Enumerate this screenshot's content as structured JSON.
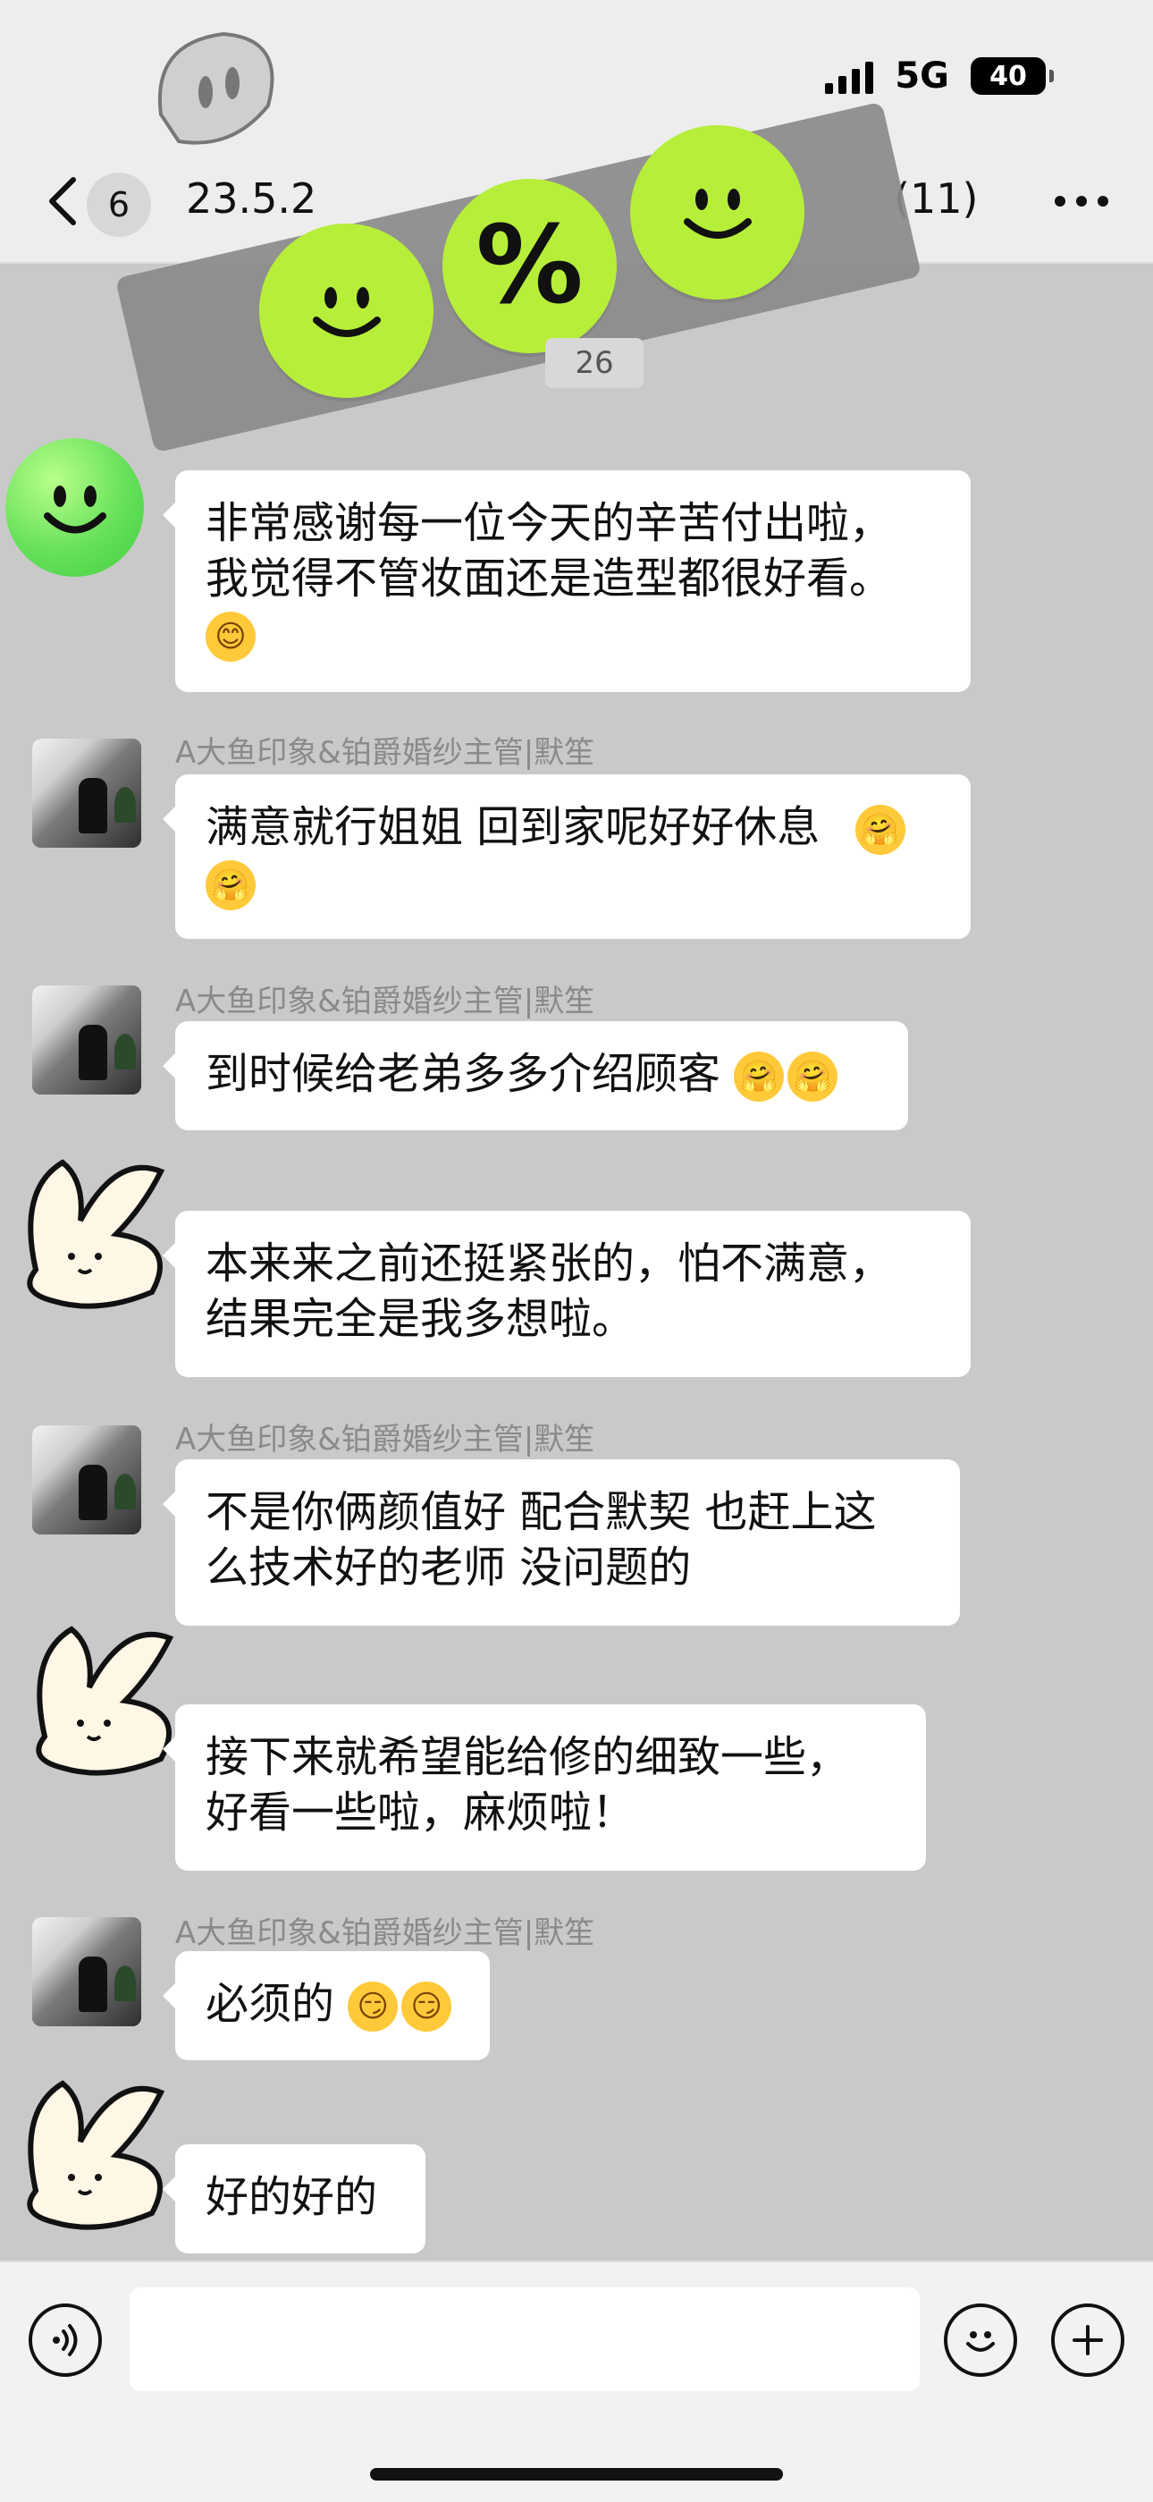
{
  "status_bar": {
    "network": "5G",
    "battery": "40"
  },
  "nav": {
    "back_count": "6",
    "title": "23.5.2",
    "member_count": "(11)"
  },
  "chat": {
    "time_chip": "26",
    "messages": [
      {
        "sender": "",
        "text_lines": [
          "非常感谢每一位今天的辛苦付出啦，",
          "我觉得不管妆面还是造型都很好看。"
        ],
        "emoji_line": "😊"
      },
      {
        "sender": "A大鱼印象&铂爵婚纱主管|默笙",
        "text_lines": [
          "满意就行姐姐 回到家呢好好休息"
        ],
        "emoji_line": "🤗🤗"
      },
      {
        "sender": "A大鱼印象&铂爵婚纱主管|默笙",
        "text_lines": [
          "到时候给老弟多多介绍顾客"
        ],
        "emoji_line": "🤗🤗"
      },
      {
        "sender": "",
        "text_lines": [
          "本来来之前还挺紧张的，怕不满意，",
          "结果完全是我多想啦。"
        ]
      },
      {
        "sender": "A大鱼印象&铂爵婚纱主管|默笙",
        "text_lines": [
          "不是你俩颜值好 配合默契 也赶上这",
          "么技术好的老师 没问题的"
        ]
      },
      {
        "sender": "",
        "text_lines": [
          "接下来就希望能给修的细致一些，",
          "好看一些啦，麻烦啦！"
        ]
      },
      {
        "sender": "A大鱼印象&铂爵婚纱主管|默笙",
        "text_lines": [
          "必须的"
        ],
        "emoji_line": "😏😏"
      },
      {
        "sender": "",
        "text_lines": [
          "好的好的"
        ]
      }
    ]
  },
  "input": {
    "placeholder": ""
  },
  "icons": {
    "back": "chevron-left-icon",
    "more": "more-horizontal-icon",
    "voice": "voice-icon",
    "emoji": "smile-icon",
    "add": "plus-circle-icon"
  },
  "colors": {
    "chat_bg": "#c9c9c9",
    "bubble_bg": "#ffffff",
    "sticker_green": "#b7ee3a"
  },
  "stickers": {
    "percent": "%"
  }
}
